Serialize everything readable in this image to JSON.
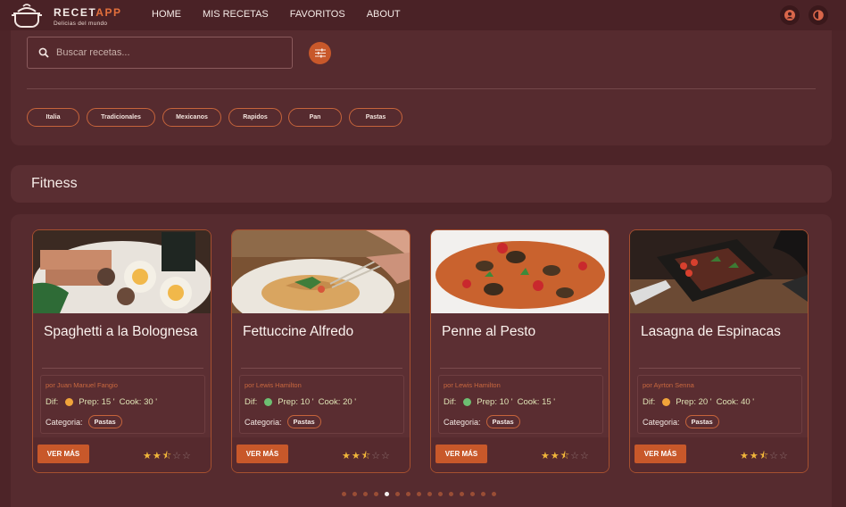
{
  "brand": {
    "name_part1": "RECET",
    "name_part2": "APP",
    "tagline": "Delicias del mundo"
  },
  "nav": [
    {
      "label": "HOME"
    },
    {
      "label": "MIS RECETAS"
    },
    {
      "label": "FAVORITOS"
    },
    {
      "label": "ABOUT"
    }
  ],
  "header_actions": {
    "account_icon": "account-circle-icon",
    "theme_icon": "contrast-icon"
  },
  "search": {
    "placeholder": "Buscar recetas...",
    "value": ""
  },
  "filters": [
    "Italia",
    "Tradicionales",
    "Mexicanos",
    "Rapidos",
    "Pan",
    "Pastas"
  ],
  "section": {
    "title": "Fitness"
  },
  "cards": [
    {
      "title": "Spaghetti a la Bolognesa",
      "author": "por Juan Manuel Fangio",
      "dif_label": "Dif:",
      "dif_color": "#f0a43a",
      "prep": "Prep: 15 '",
      "cook": "Cook: 30 '",
      "cat_label": "Categoria:",
      "category": "Pastas",
      "button": "VER MÁS",
      "rating": 2.5,
      "rating_max": 5
    },
    {
      "title": "Fettuccine Alfredo",
      "author": "por Lewis Hamilton",
      "dif_label": "Dif:",
      "dif_color": "#6dbf72",
      "prep": "Prep: 10 '",
      "cook": "Cook: 20 '",
      "cat_label": "Categoria:",
      "category": "Pastas",
      "button": "VER MÁS",
      "rating": 2.5,
      "rating_max": 5
    },
    {
      "title": "Penne al Pesto",
      "author": "por Lewis Hamilton",
      "dif_label": "Dif:",
      "dif_color": "#6dbf72",
      "prep": "Prep: 10 '",
      "cook": "Cook: 15 '",
      "cat_label": "Categoria:",
      "category": "Pastas",
      "button": "VER MÁS",
      "rating": 2.5,
      "rating_max": 5
    },
    {
      "title": "Lasagna de Espinacas",
      "author": "por Ayrton Senna",
      "dif_label": "Dif:",
      "dif_color": "#f0a43a",
      "prep": "Prep: 20 '",
      "cook": "Cook: 40 '",
      "cat_label": "Categoria:",
      "category": "Pastas",
      "button": "VER MÁS",
      "rating": 2.5,
      "rating_max": 5
    }
  ],
  "pagination": {
    "count": 15,
    "active_index": 4
  },
  "colors": {
    "accent": "#c8582a",
    "background": "#4d2428",
    "panel": "#562b2f"
  }
}
